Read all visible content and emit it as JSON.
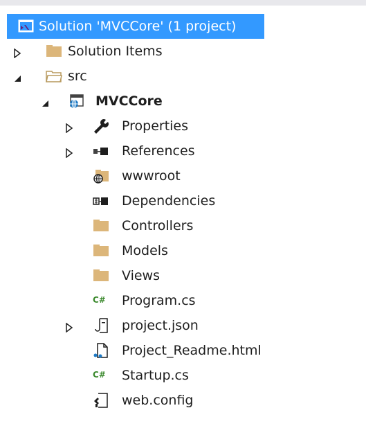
{
  "solution_explorer": {
    "nodes": [
      {
        "label": "Solution 'MVCCore' (1 project)",
        "icon": "visual-studio-solution-icon",
        "expander": "none",
        "selected": true
      },
      {
        "label": "Solution Items",
        "icon": "folder-icon",
        "expander": "collapsed"
      },
      {
        "label": "src",
        "icon": "folder-open-icon",
        "expander": "expanded"
      },
      {
        "label": "MVCCore",
        "icon": "web-project-icon",
        "expander": "expanded",
        "bold": true
      },
      {
        "label": "Properties",
        "icon": "wrench-icon",
        "expander": "collapsed"
      },
      {
        "label": "References",
        "icon": "references-icon",
        "expander": "collapsed"
      },
      {
        "label": "wwwroot",
        "icon": "web-folder-icon",
        "expander": "none"
      },
      {
        "label": "Dependencies",
        "icon": "dependencies-icon",
        "expander": "none"
      },
      {
        "label": "Controllers",
        "icon": "folder-icon",
        "expander": "none"
      },
      {
        "label": "Models",
        "icon": "folder-icon",
        "expander": "none"
      },
      {
        "label": "Views",
        "icon": "folder-icon",
        "expander": "none"
      },
      {
        "label": "Program.cs",
        "icon": "csharp-file-icon",
        "expander": "none"
      },
      {
        "label": "project.json",
        "icon": "json-file-icon",
        "expander": "collapsed"
      },
      {
        "label": "Project_Readme.html",
        "icon": "html-file-icon",
        "expander": "none"
      },
      {
        "label": "Startup.cs",
        "icon": "csharp-file-icon",
        "expander": "none"
      },
      {
        "label": "web.config",
        "icon": "config-file-icon",
        "expander": "none"
      }
    ],
    "csharp_glyph": "C#"
  },
  "colors": {
    "selection": "#3399ff",
    "folder": "#dcb67a",
    "csharp": "#3c8a2e",
    "project": "#1e7ac4"
  }
}
